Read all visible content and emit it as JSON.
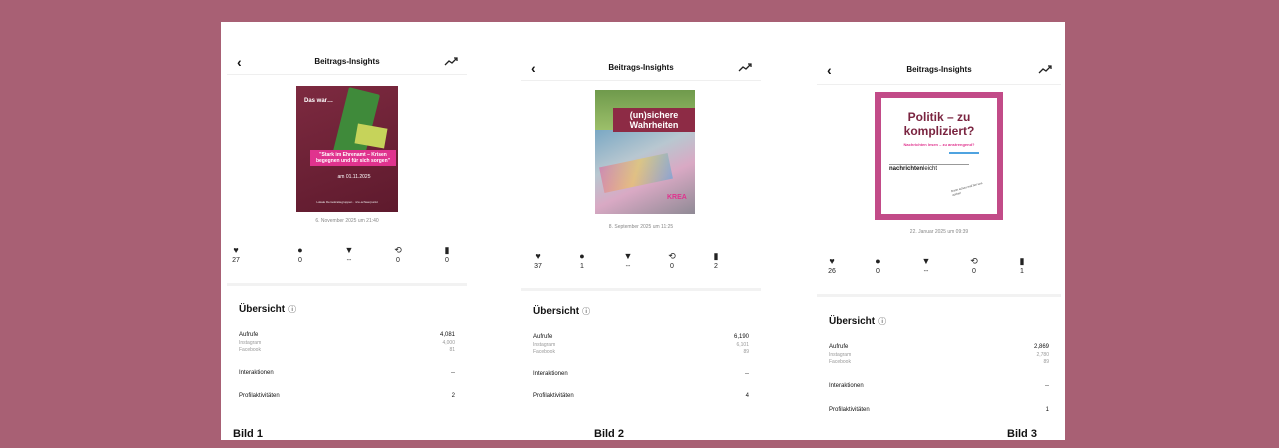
{
  "panels": [
    {
      "title": "Beitrags-Insights",
      "post": {
        "kicker": "Das war…",
        "headline": "\"Stark im Ehrenamt – Krisen begegnen und für sich sorgen\"",
        "date_line": "am 01.11.2025",
        "footer": "Lokale Demokratiegruppen · nrw-schwerpunkt"
      },
      "date": "6. November 2025 um 21:40",
      "metrics": {
        "likes": "27",
        "comments": "0",
        "shares": "--",
        "reposts": "0",
        "saves": "0"
      },
      "overview_title": "Übersicht",
      "views_label": "Aufrufe",
      "views_value": "4,081",
      "instagram_label": "Instagram",
      "instagram_value": "4,000",
      "facebook_label": "Facebook",
      "facebook_value": "81",
      "interactions_label": "Interaktionen",
      "interactions_value": "--",
      "profile_label": "Profilaktivitäten",
      "profile_value": "2",
      "caption": "Bild 1"
    },
    {
      "title": "Beitrags-Insights",
      "post": {
        "headline_a": "(un)sichere",
        "headline_b": "Wahrheiten",
        "tag": "KREA"
      },
      "date": "8. September 2025 um 11:25",
      "metrics": {
        "likes": "37",
        "comments": "1",
        "shares": "--",
        "reposts": "0",
        "saves": "2"
      },
      "overview_title": "Übersicht",
      "views_label": "Aufrufe",
      "views_value": "6,190",
      "instagram_label": "Instagram",
      "instagram_value": "6,101",
      "facebook_label": "Facebook",
      "facebook_value": "89",
      "interactions_label": "Interaktionen",
      "interactions_value": "--",
      "profile_label": "Profilaktivitäten",
      "profile_value": "4",
      "caption": "Bild 2"
    },
    {
      "title": "Beitrags-Insights",
      "post": {
        "headline": "Politik – zu kompliziert?",
        "subline": "Nachrichten lesen – zu anstrengend?",
        "brand_a": "nachrichten",
        "brand_b": "leicht",
        "scribble": "Dann schau mal bei uns vorbei!"
      },
      "date": "22. Januar 2025 um 09:39",
      "metrics": {
        "likes": "26",
        "comments": "0",
        "shares": "--",
        "reposts": "0",
        "saves": "1"
      },
      "overview_title": "Übersicht",
      "views_label": "Aufrufe",
      "views_value": "2,869",
      "instagram_label": "Instagram",
      "instagram_value": "2,780",
      "facebook_label": "Facebook",
      "facebook_value": "89",
      "interactions_label": "Interaktionen",
      "interactions_value": "--",
      "profile_label": "Profilaktivitäten",
      "profile_value": "1",
      "caption": "Bild 3"
    }
  ],
  "icons": {
    "back": "chevron-left-icon",
    "trend": "trend-icon",
    "likes": "heart-icon",
    "comments": "comment-icon",
    "shares": "share-icon",
    "reposts": "repost-icon",
    "saves": "bookmark-icon",
    "info": "info-icon"
  },
  "colors": {
    "background": "#a86074",
    "brand_magenta": "#e0338e",
    "burgundy": "#7a2440"
  }
}
